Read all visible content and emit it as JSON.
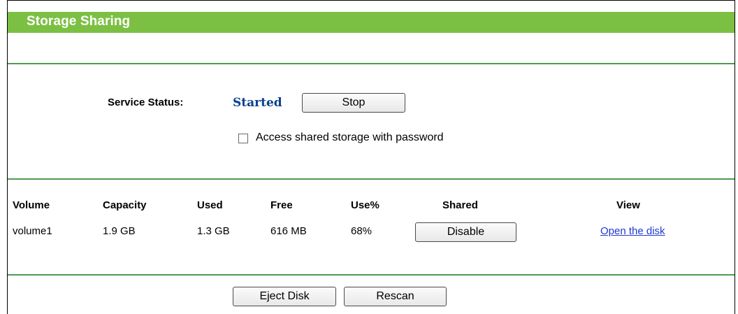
{
  "title": "Storage Sharing",
  "service": {
    "label": "Service Status:",
    "status": "Started",
    "stop_button": "Stop",
    "password_checkbox_label": "Access shared storage with password",
    "password_checked": false
  },
  "table": {
    "headers": [
      "Volume",
      "Capacity",
      "Used",
      "Free",
      "Use%",
      "Shared",
      "View"
    ],
    "rows": [
      {
        "volume": "volume1",
        "capacity": "1.9 GB",
        "used": "1.3 GB",
        "free": "616 MB",
        "use_pct": "68%",
        "shared_button": "Disable",
        "view_link": "Open the disk"
      }
    ]
  },
  "footer": {
    "eject_button": "Eject Disk",
    "rescan_button": "Rescan"
  },
  "colors": {
    "title_bar": "#7bc043",
    "divider": "#4f9a52",
    "status_text": "#0a3f8f",
    "link": "#1f3ad1"
  }
}
